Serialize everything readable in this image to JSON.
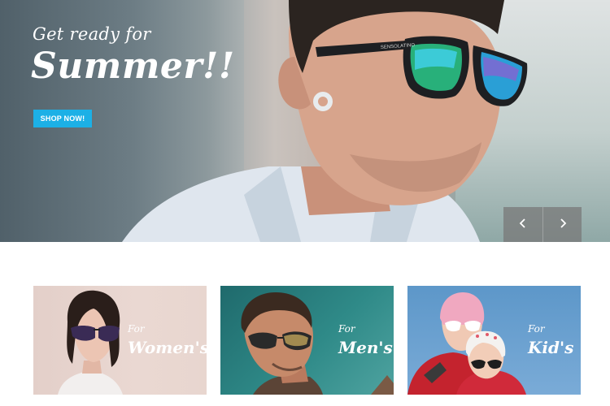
{
  "hero": {
    "headline_small": "Get ready for",
    "headline_big": "Summer!!",
    "cta_label": "SHOP NOW!",
    "brand_on_glasses": "SENSOLATINO",
    "accent_color": "#1cb0e6",
    "prev_icon": "chevron-left-icon",
    "next_icon": "chevron-right-icon"
  },
  "categories": [
    {
      "for_label": "For",
      "name": "Women's"
    },
    {
      "for_label": "For",
      "name": "Men's"
    },
    {
      "for_label": "For",
      "name": "Kid's"
    }
  ]
}
